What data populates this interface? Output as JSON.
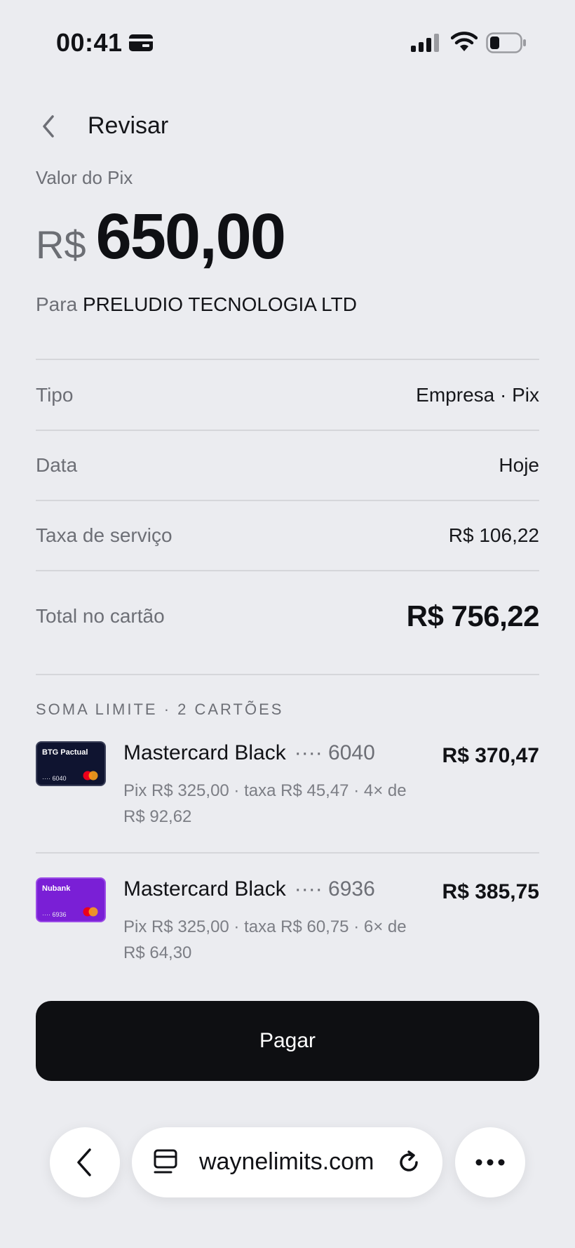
{
  "status_bar": {
    "time": "00:41",
    "icons": [
      "wallet-icon",
      "signal-icon",
      "wifi-icon",
      "battery-icon"
    ]
  },
  "header": {
    "title": "Revisar",
    "back_icon": "chevron-left-icon"
  },
  "amount": {
    "label": "Valor do Pix",
    "currency": "R$",
    "value": "650,00"
  },
  "recipient": {
    "prefix": "Para",
    "name": "PRELUDIO TECNOLOGIA LTD"
  },
  "details": [
    {
      "label": "Tipo",
      "value": "Empresa · Pix"
    },
    {
      "label": "Data",
      "value": "Hoje"
    },
    {
      "label": "Taxa de serviço",
      "value": "R$ 106,22"
    }
  ],
  "total": {
    "label": "Total no cartão",
    "value": "R$ 756,22"
  },
  "cards_section": {
    "title": "SOMA LIMITE · 2 CARTÕES",
    "cards": [
      {
        "bank": "BTG Pactual",
        "thumb_digits": "···· 6040",
        "name": "Mastercard Black",
        "mask": "···· 6040",
        "description": "Pix R$ 325,00 · taxa R$ 45,47 · 4× de R$ 92,62",
        "amount": "R$ 370,47"
      },
      {
        "bank": "Nubank",
        "thumb_digits": "···· 6936",
        "name": "Mastercard Black",
        "mask": "···· 6936",
        "description": "Pix R$ 325,00 · taxa R$ 60,75 · 6× de R$ 64,30",
        "amount": "R$ 385,75"
      }
    ]
  },
  "pay_button": {
    "label": "Pagar"
  },
  "browser": {
    "url": "waynelimits.com",
    "icons": [
      "chevron-left-icon",
      "tabs-icon",
      "reload-icon",
      "more-icon"
    ]
  },
  "colors": {
    "background": "#ebecf0",
    "primary_button": "#0e0f12",
    "btg_card": "#0f1430",
    "nubank_card": "#7a1fd6"
  }
}
